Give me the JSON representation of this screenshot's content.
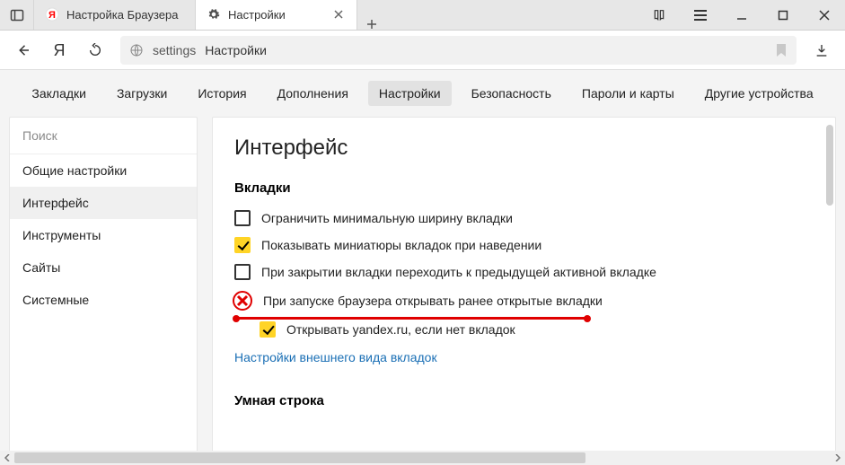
{
  "titlebar": {
    "tabs": [
      {
        "title": "Настройка Браузера",
        "favicon": "yandex"
      },
      {
        "title": "Настройки",
        "favicon": "gear",
        "active": true
      }
    ]
  },
  "toolbar": {
    "url_host": "settings",
    "url_rest": "Настройки"
  },
  "topnav": {
    "items": [
      "Закладки",
      "Загрузки",
      "История",
      "Дополнения",
      "Настройки",
      "Безопасность",
      "Пароли и карты",
      "Другие устройства"
    ],
    "active_index": 4
  },
  "sidebar": {
    "search_placeholder": "Поиск",
    "items": [
      "Общие настройки",
      "Интерфейс",
      "Инструменты",
      "Сайты",
      "Системные"
    ],
    "active_index": 1
  },
  "main": {
    "heading": "Интерфейс",
    "section_tabs_title": "Вкладки",
    "options": [
      {
        "label": "Ограничить минимальную ширину вкладки",
        "checked": false
      },
      {
        "label": "Показывать миниатюры вкладок при наведении",
        "checked": true
      },
      {
        "label": "При закрытии вкладки переходить к предыдущей активной вкладке",
        "checked": false
      },
      {
        "label": "При запуске браузера открывать ранее открытые вкладки",
        "checked": false,
        "annotated": true
      },
      {
        "label": "Открывать yandex.ru, если нет вкладок",
        "checked": true,
        "indent": true
      }
    ],
    "tabs_appearance_link": "Настройки внешнего вида вкладок",
    "section_omnibox_title": "Умная строка"
  }
}
